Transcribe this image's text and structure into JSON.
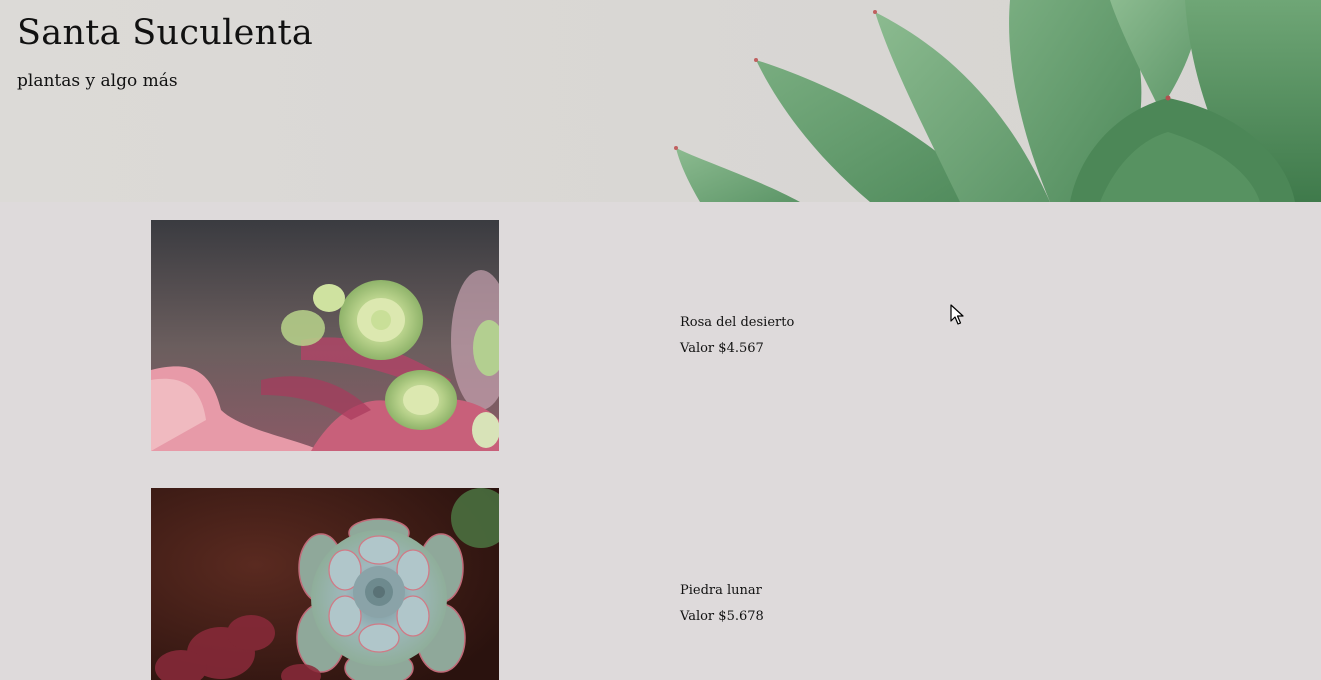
{
  "header": {
    "title": "Santa Suculenta",
    "subtitle": "plantas y algo más"
  },
  "products": [
    {
      "name": "Rosa del desierto",
      "price_prefix": "Valor",
      "price": "$4.567",
      "image_icon": "succulent-rose-photo"
    },
    {
      "name": "Piedra lunar",
      "price_prefix": "Valor",
      "price": "$5.678",
      "image_icon": "echeveria-photo"
    }
  ],
  "colors": {
    "background": "#dedadb",
    "hero_background": "#d9d7d4",
    "leaf_green": "#5e9a6a",
    "text": "#111111"
  }
}
